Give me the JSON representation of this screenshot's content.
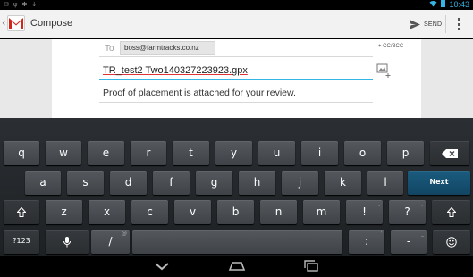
{
  "status_bar": {
    "time": "10:43",
    "left_icons": [
      "gmail-notification-icon",
      "usb-icon",
      "debug-icon",
      "download-icon"
    ],
    "right_icons": [
      "wifi-icon",
      "battery-icon"
    ],
    "accent": "#33b5e5"
  },
  "action_bar": {
    "title": "Compose",
    "send_label": "SEND"
  },
  "compose": {
    "to_label": "To",
    "recipient": "boss@farmtracks.co.nz",
    "cc_bcc_label": "+ CC/BCC",
    "subject": "TR_test2 Two140327223923.gpx",
    "body": "Proof of placement is attached for your review."
  },
  "keyboard": {
    "row1": [
      "q",
      "w",
      "e",
      "r",
      "t",
      "y",
      "u",
      "i",
      "o",
      "p"
    ],
    "row2": [
      "a",
      "s",
      "d",
      "f",
      "g",
      "h",
      "j",
      "k",
      "l"
    ],
    "row3": [
      "z",
      "x",
      "c",
      "v",
      "b",
      "n",
      "m",
      "!",
      "?"
    ],
    "row3_subs": [
      "",
      "",
      "",
      "",
      "",
      "",
      "",
      ",",
      "."
    ],
    "next_label": "Next",
    "numbers_label": "?123",
    "slash_label": "/",
    "slash_sub": "@",
    "colon_label": ":",
    "colon_sub": "'",
    "dash_label": "-",
    "dash_sub": "_",
    "accent_color": "#1b5c7f"
  }
}
